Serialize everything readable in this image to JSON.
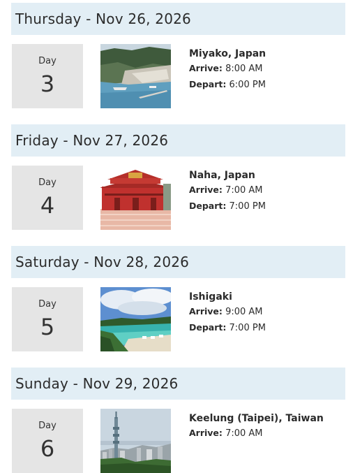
{
  "itinerary": {
    "days": [
      {
        "date_header": "Thursday - Nov 26, 2026",
        "day_label": "Day",
        "day_number": "3",
        "port": "Miyako, Japan",
        "arrive_label": "Arrive:",
        "arrive_time": "8:00 AM",
        "depart_label": "Depart:",
        "depart_time": "6:00 PM",
        "image": "harbor-aerial-photo"
      },
      {
        "date_header": "Friday - Nov 27, 2026",
        "day_label": "Day",
        "day_number": "4",
        "port": "Naha, Japan",
        "arrive_label": "Arrive:",
        "arrive_time": "7:00 AM",
        "depart_label": "Depart:",
        "depart_time": "7:00 PM",
        "image": "red-castle-photo"
      },
      {
        "date_header": "Saturday - Nov 28, 2026",
        "day_label": "Day",
        "day_number": "5",
        "port": "Ishigaki",
        "arrive_label": "Arrive:",
        "arrive_time": "9:00 AM",
        "depart_label": "Depart:",
        "depart_time": "7:00 PM",
        "image": "beach-bay-photo"
      },
      {
        "date_header": "Sunday - Nov 29, 2026",
        "day_label": "Day",
        "day_number": "6",
        "port": "Keelung (Taipei), Taiwan",
        "arrive_label": "Arrive:",
        "arrive_time": "7:00 AM",
        "image": "city-skyline-photo"
      }
    ]
  }
}
